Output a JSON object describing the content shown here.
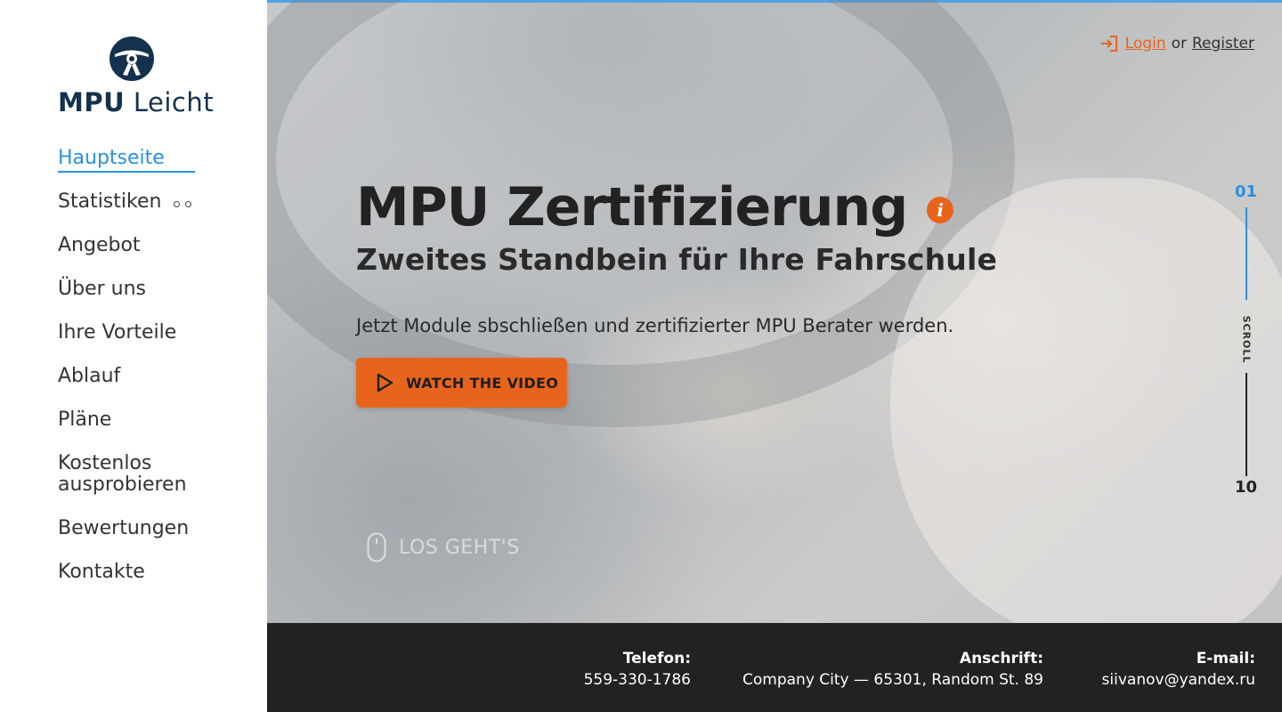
{
  "brand": {
    "name_bold": "MPU",
    "name_light": "Leicht",
    "logo_icon": "steering-wheel-icon",
    "color": "#14314d"
  },
  "nav": {
    "items": [
      {
        "label": "Hauptseite",
        "active": true
      },
      {
        "label": "Statistiken",
        "has_submenu": true
      },
      {
        "label": "Angebot"
      },
      {
        "label": "Über uns"
      },
      {
        "label": "Ihre Vorteile"
      },
      {
        "label": "Ablauf"
      },
      {
        "label": "Pläne"
      },
      {
        "label": "Kostenlos ausprobieren"
      },
      {
        "label": "Bewertungen"
      },
      {
        "label": "Kontakte"
      }
    ]
  },
  "auth": {
    "login_label": "Login",
    "or_label": "or",
    "register_label": "Register",
    "icon": "login-icon"
  },
  "hero": {
    "title": "MPU Zertifizierung",
    "subtitle": "Zweites Standbein für Ihre Fahrschule",
    "lead": "Jetzt Module sbschließen und zertifizierter MPU Berater werden.",
    "video_button": "WATCH THE VIDEO",
    "start_label": "LOS GEHT'S",
    "info_icon": "info-icon"
  },
  "scroll": {
    "current": "01",
    "label": "SCROLL",
    "total": "10"
  },
  "footer": {
    "phone_label": "Telefon:",
    "phone": "559-330-1786",
    "address_label": "Anschrift:",
    "address": "Company City — 65301, Random St. 89",
    "email_label": "E-mail:",
    "email": "siivanov@yandex.ru"
  },
  "colors": {
    "accent": "#e8641c",
    "highlight": "#2b8fe0",
    "footer_bg": "#222222"
  }
}
